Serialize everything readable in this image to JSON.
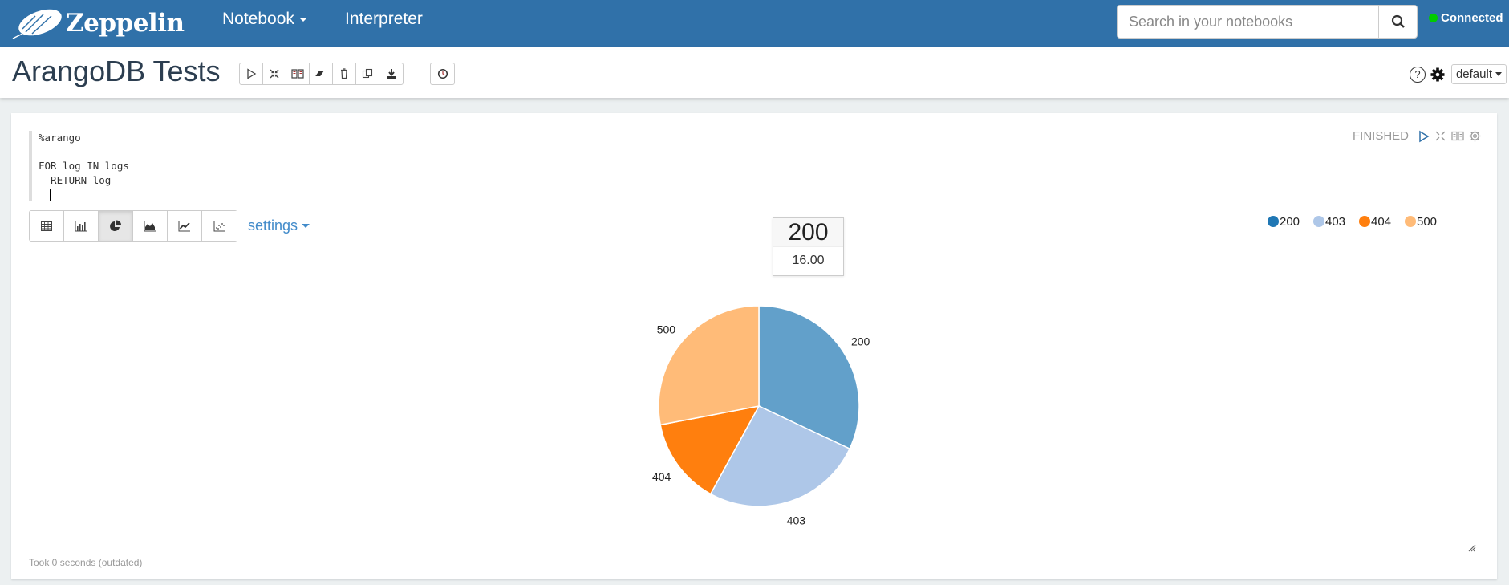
{
  "navbar": {
    "brand": "Zeppelin",
    "menu": [
      {
        "label": "Notebook",
        "has_dropdown": true
      },
      {
        "label": "Interpreter",
        "has_dropdown": false
      }
    ],
    "search": {
      "placeholder": "Search in your notebooks",
      "value": ""
    },
    "connection_status": "Connected",
    "connection_color": "#00cc00",
    "bg_color": "#3071a9"
  },
  "note": {
    "title": "ArangoDB Tests",
    "toolbar_icons": [
      "run-all-icon",
      "hide-code-icon",
      "hide-output-icon",
      "clear-output-icon",
      "delete-icon",
      "clone-icon",
      "export-icon"
    ],
    "scheduler_icon": "clock-icon",
    "right": {
      "help_icon": "help-icon",
      "settings_icon": "gear-icon",
      "interpreter_binding": "default"
    }
  },
  "paragraph": {
    "code_lines": [
      "%arango",
      "",
      "FOR log IN logs",
      "  RETURN log"
    ],
    "status": "FINISHED",
    "status_icons": [
      "run-icon",
      "hide-code-icon",
      "hide-output-icon",
      "settings-icon"
    ],
    "viz_modes": [
      {
        "name": "table",
        "active": false
      },
      {
        "name": "bar-chart",
        "active": false
      },
      {
        "name": "pie-chart",
        "active": true
      },
      {
        "name": "area-chart",
        "active": false
      },
      {
        "name": "line-chart",
        "active": false
      },
      {
        "name": "scatter-chart",
        "active": false
      }
    ],
    "settings_label": "settings",
    "footer": "Took 0 seconds (outdated)",
    "tooltip": {
      "label": "200",
      "value": "16.00"
    }
  },
  "chart_data": {
    "type": "pie",
    "title": "",
    "categories": [
      "200",
      "403",
      "404",
      "500"
    ],
    "values": [
      16,
      13,
      7,
      14
    ],
    "colors": [
      "#1f77b4",
      "#aec7e8",
      "#ff7f0e",
      "#ffbb78"
    ],
    "slice_colors": [
      "#62a0ca",
      "#aec7e8",
      "#ff7f0e",
      "#ffbb78"
    ],
    "legend": {
      "entries": [
        "200",
        "403",
        "404",
        "500"
      ],
      "placement": "top-right"
    },
    "start_angle_deg": 0,
    "direction": "clockwise"
  }
}
